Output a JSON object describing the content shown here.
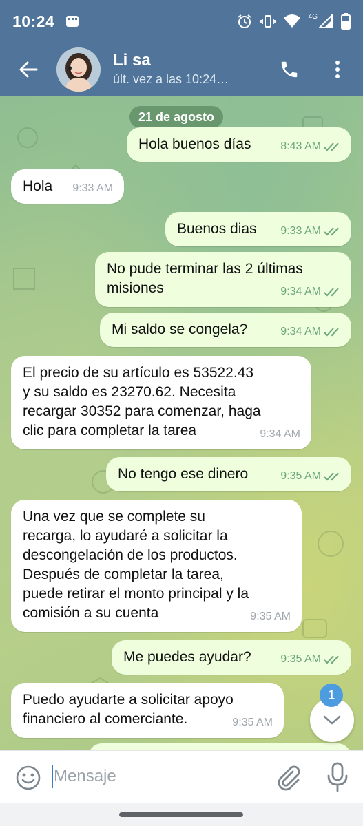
{
  "status_bar": {
    "time": "10:24",
    "network": "4G",
    "icons": [
      "notification-icon",
      "alarm-icon",
      "vibrate-icon",
      "wifi-icon",
      "signal-icon",
      "battery-icon"
    ]
  },
  "header": {
    "contact_name": "Li sa",
    "last_seen": "últ. vez a las 10:24…",
    "icons": [
      "back-arrow-icon",
      "avatar",
      "phone-icon",
      "more-vert-icon"
    ]
  },
  "chat": {
    "date_chip": "21 de agosto",
    "messages": [
      {
        "direction": "out",
        "text": "Hola buenos días",
        "time": "8:43 AM",
        "read": true
      },
      {
        "direction": "in",
        "text": "Hola",
        "time": "9:33 AM"
      },
      {
        "direction": "out",
        "text": "Buenos dias",
        "time": "9:33 AM",
        "read": true
      },
      {
        "direction": "out",
        "text": "No pude terminar las 2 últimas\nmisiones",
        "time": "9:34 AM",
        "read": true
      },
      {
        "direction": "out",
        "text": "Mi saldo se congela?",
        "time": "9:34 AM",
        "read": true
      },
      {
        "direction": "in",
        "text": "El precio de su artículo es 53522.43\ny su saldo es 23270.62. Necesita\nrecargar 30352 para comenzar, haga\nclic para completar la tarea",
        "time": "9:34 AM"
      },
      {
        "direction": "out",
        "text": "No tengo ese dinero",
        "time": "9:35 AM",
        "read": true
      },
      {
        "direction": "in",
        "text": "Una vez que se complete su\nrecarga, lo ayudaré a solicitar la\ndescongelación de los productos.\nDespués de completar la tarea,\npuede retirar el monto principal y la\ncomisión a su cuenta",
        "time": "9:35 AM"
      },
      {
        "direction": "out",
        "text": "Me puedes ayudar?",
        "time": "9:35 AM",
        "read": true
      },
      {
        "direction": "in",
        "text": "Puedo ayudarte a solicitar apoyo\nfinanciero al comerciante.",
        "time": "9:35 AM"
      }
    ],
    "unread_count": "1"
  },
  "input_bar": {
    "placeholder": "Mensaje",
    "icons": [
      "emoji-icon",
      "attach-icon",
      "mic-icon"
    ]
  },
  "colors": {
    "header": "#50749a",
    "outgoing_bubble": "#effedd",
    "incoming_bubble": "#ffffff",
    "read_ticks": "#6ca77a",
    "badge": "#4d9ce0"
  }
}
